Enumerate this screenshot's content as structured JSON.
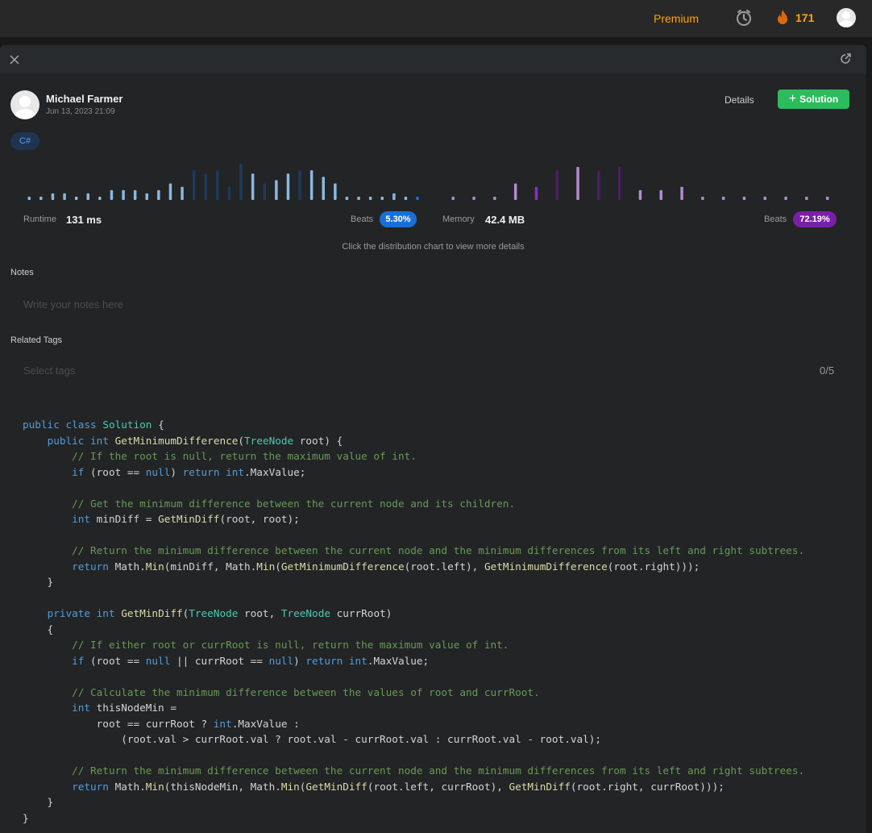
{
  "topbar": {
    "premium_label": "Premium",
    "streak_count": "171"
  },
  "panel": {
    "user": {
      "name": "Michael Farmer",
      "date": "Jun 13, 2023 21:09"
    },
    "details_label": "Details",
    "solution_label": "Solution",
    "language": "C#",
    "stats": {
      "runtime_label": "Runtime",
      "runtime_value": "131 ms",
      "runtime_beats_label": "Beats",
      "runtime_beats": "5.30%",
      "memory_label": "Memory",
      "memory_value": "42.4 MB",
      "memory_beats_label": "Beats",
      "memory_beats": "72.19%"
    },
    "hint": "Click the distribution chart to view more details",
    "notes": {
      "label": "Notes",
      "placeholder": "Write your notes here"
    },
    "tags": {
      "label": "Related Tags",
      "placeholder": "Select tags",
      "count": "0/5"
    }
  },
  "chart_data": [
    {
      "type": "bar",
      "x": [
        1,
        2,
        3,
        4,
        5,
        6,
        7,
        8,
        9,
        10,
        11,
        12,
        13,
        14,
        15,
        16,
        17,
        18,
        19,
        20,
        21,
        22,
        23,
        24,
        25,
        26,
        27,
        28,
        29,
        30,
        31,
        32,
        33,
        34,
        35,
        36
      ],
      "values": [
        1,
        1,
        2,
        2,
        1,
        2,
        1,
        3,
        3,
        3,
        2,
        3,
        5,
        4,
        9,
        8,
        9,
        4,
        11,
        8,
        5,
        6,
        8,
        9,
        9,
        7,
        5,
        1,
        1,
        1,
        1,
        2,
        1,
        1
      ],
      "current_index": 33
    },
    {
      "type": "bar",
      "x": [
        1,
        2,
        3,
        4,
        5,
        6,
        7,
        8,
        9,
        10,
        11,
        12,
        13,
        14,
        15,
        16,
        17,
        18,
        19
      ],
      "values": [
        1,
        1,
        1,
        5,
        4,
        9,
        10,
        9,
        10,
        3,
        3,
        4,
        1,
        1,
        1,
        1,
        1,
        1,
        1
      ],
      "current_index": 4
    }
  ],
  "code": [
    [
      [
        "k",
        "public "
      ],
      [
        "k",
        "class "
      ],
      [
        "t",
        "Solution"
      ],
      [
        "p",
        " {"
      ]
    ],
    [
      [
        "p",
        "    "
      ],
      [
        "k",
        "public "
      ],
      [
        "k",
        "int "
      ],
      [
        "f",
        "GetMinimumDifference"
      ],
      [
        "p",
        "("
      ],
      [
        "t",
        "TreeNode"
      ],
      [
        "p",
        " root) {"
      ]
    ],
    [
      [
        "p",
        "        "
      ],
      [
        "c",
        "// If the root is null, return the maximum value of int."
      ]
    ],
    [
      [
        "p",
        "        "
      ],
      [
        "k",
        "if"
      ],
      [
        "p",
        " (root == "
      ],
      [
        "k",
        "null"
      ],
      [
        "p",
        ") "
      ],
      [
        "k",
        "return "
      ],
      [
        "k",
        "int"
      ],
      [
        "p",
        ".MaxValue;"
      ]
    ],
    [
      [
        "p",
        ""
      ]
    ],
    [
      [
        "p",
        "        "
      ],
      [
        "c",
        "// Get the minimum difference between the current node and its children."
      ]
    ],
    [
      [
        "p",
        "        "
      ],
      [
        "k",
        "int"
      ],
      [
        "p",
        " minDiff = "
      ],
      [
        "f",
        "GetMinDiff"
      ],
      [
        "p",
        "(root, root);"
      ]
    ],
    [
      [
        "p",
        ""
      ]
    ],
    [
      [
        "p",
        "        "
      ],
      [
        "c",
        "// Return the minimum difference between the current node and the minimum differences from its left and right subtrees."
      ]
    ],
    [
      [
        "p",
        "        "
      ],
      [
        "k",
        "return"
      ],
      [
        "p",
        " Math."
      ],
      [
        "f",
        "Min"
      ],
      [
        "p",
        "(minDiff, Math."
      ],
      [
        "f",
        "Min"
      ],
      [
        "p",
        "("
      ],
      [
        "f",
        "GetMinimumDifference"
      ],
      [
        "p",
        "(root.left), "
      ],
      [
        "f",
        "GetMinimumDifference"
      ],
      [
        "p",
        "(root.right)));"
      ]
    ],
    [
      [
        "p",
        "    }"
      ]
    ],
    [
      [
        "p",
        ""
      ]
    ],
    [
      [
        "p",
        "    "
      ],
      [
        "k",
        "private "
      ],
      [
        "k",
        "int "
      ],
      [
        "f",
        "GetMinDiff"
      ],
      [
        "p",
        "("
      ],
      [
        "t",
        "TreeNode"
      ],
      [
        "p",
        " root, "
      ],
      [
        "t",
        "TreeNode"
      ],
      [
        "p",
        " currRoot)"
      ]
    ],
    [
      [
        "p",
        "    {"
      ]
    ],
    [
      [
        "p",
        "        "
      ],
      [
        "c",
        "// If either root or currRoot is null, return the maximum value of int."
      ]
    ],
    [
      [
        "p",
        "        "
      ],
      [
        "k",
        "if"
      ],
      [
        "p",
        " (root == "
      ],
      [
        "k",
        "null"
      ],
      [
        "p",
        " || currRoot == "
      ],
      [
        "k",
        "null"
      ],
      [
        "p",
        ") "
      ],
      [
        "k",
        "return "
      ],
      [
        "k",
        "int"
      ],
      [
        "p",
        ".MaxValue;"
      ]
    ],
    [
      [
        "p",
        ""
      ]
    ],
    [
      [
        "p",
        "        "
      ],
      [
        "c",
        "// Calculate the minimum difference between the values of root and currRoot."
      ]
    ],
    [
      [
        "p",
        "        "
      ],
      [
        "k",
        "int"
      ],
      [
        "p",
        " thisNodeMin ="
      ]
    ],
    [
      [
        "p",
        "            root == currRoot ? "
      ],
      [
        "k",
        "int"
      ],
      [
        "p",
        ".MaxValue :"
      ]
    ],
    [
      [
        "p",
        "                (root.val > currRoot.val ? root.val - currRoot.val : currRoot.val - root.val);"
      ]
    ],
    [
      [
        "p",
        ""
      ]
    ],
    [
      [
        "p",
        "        "
      ],
      [
        "c",
        "// Return the minimum difference between the current node and the minimum differences from its left and right subtrees."
      ]
    ],
    [
      [
        "p",
        "        "
      ],
      [
        "k",
        "return"
      ],
      [
        "p",
        " Math."
      ],
      [
        "f",
        "Min"
      ],
      [
        "p",
        "(thisNodeMin, Math."
      ],
      [
        "f",
        "Min"
      ],
      [
        "p",
        "("
      ],
      [
        "f",
        "GetMinDiff"
      ],
      [
        "p",
        "(root.left, currRoot), "
      ],
      [
        "f",
        "GetMinDiff"
      ],
      [
        "p",
        "(root.right, currRoot)));"
      ]
    ],
    [
      [
        "p",
        "    }"
      ]
    ],
    [
      [
        "p",
        "}"
      ]
    ]
  ]
}
